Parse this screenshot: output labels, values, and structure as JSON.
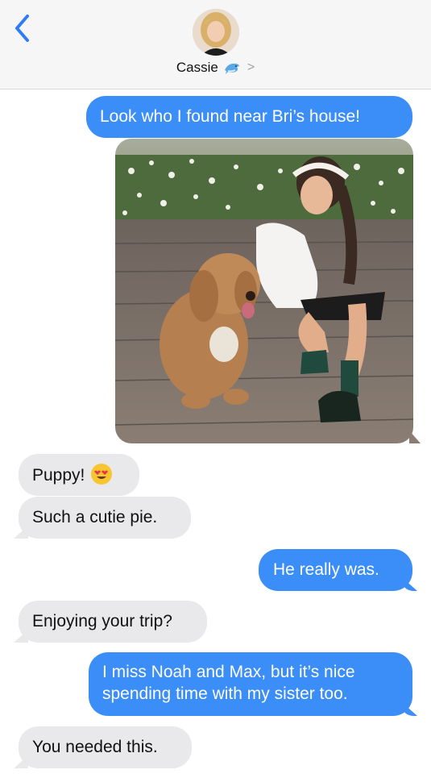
{
  "header": {
    "contact_name": "Cassie",
    "contact_emoji": "dolphin-emoji",
    "chevron": ">"
  },
  "messages": [
    {
      "from": "me",
      "text": "Look who I found near Bri’s house!"
    },
    {
      "from": "me",
      "type": "image",
      "image": "photo of woman with a fluffy golden dog"
    },
    {
      "from": "them",
      "text": "Puppy!",
      "emoji": "heart-eyes"
    },
    {
      "from": "them",
      "text": "Such a cutie pie."
    },
    {
      "from": "me",
      "text": "He really was."
    },
    {
      "from": "them",
      "text": "Enjoying your trip?"
    },
    {
      "from": "me",
      "lines": [
        "I miss Noah and Max, but it’s nice",
        "spending time with my sister too."
      ]
    },
    {
      "from": "them",
      "text": "You needed this."
    }
  ],
  "colors": {
    "outgoing_bubble": "#3b8ef7",
    "incoming_bubble": "#e9e9eb",
    "header_bg": "#f6f6f7",
    "back_arrow": "#2f7df6"
  }
}
